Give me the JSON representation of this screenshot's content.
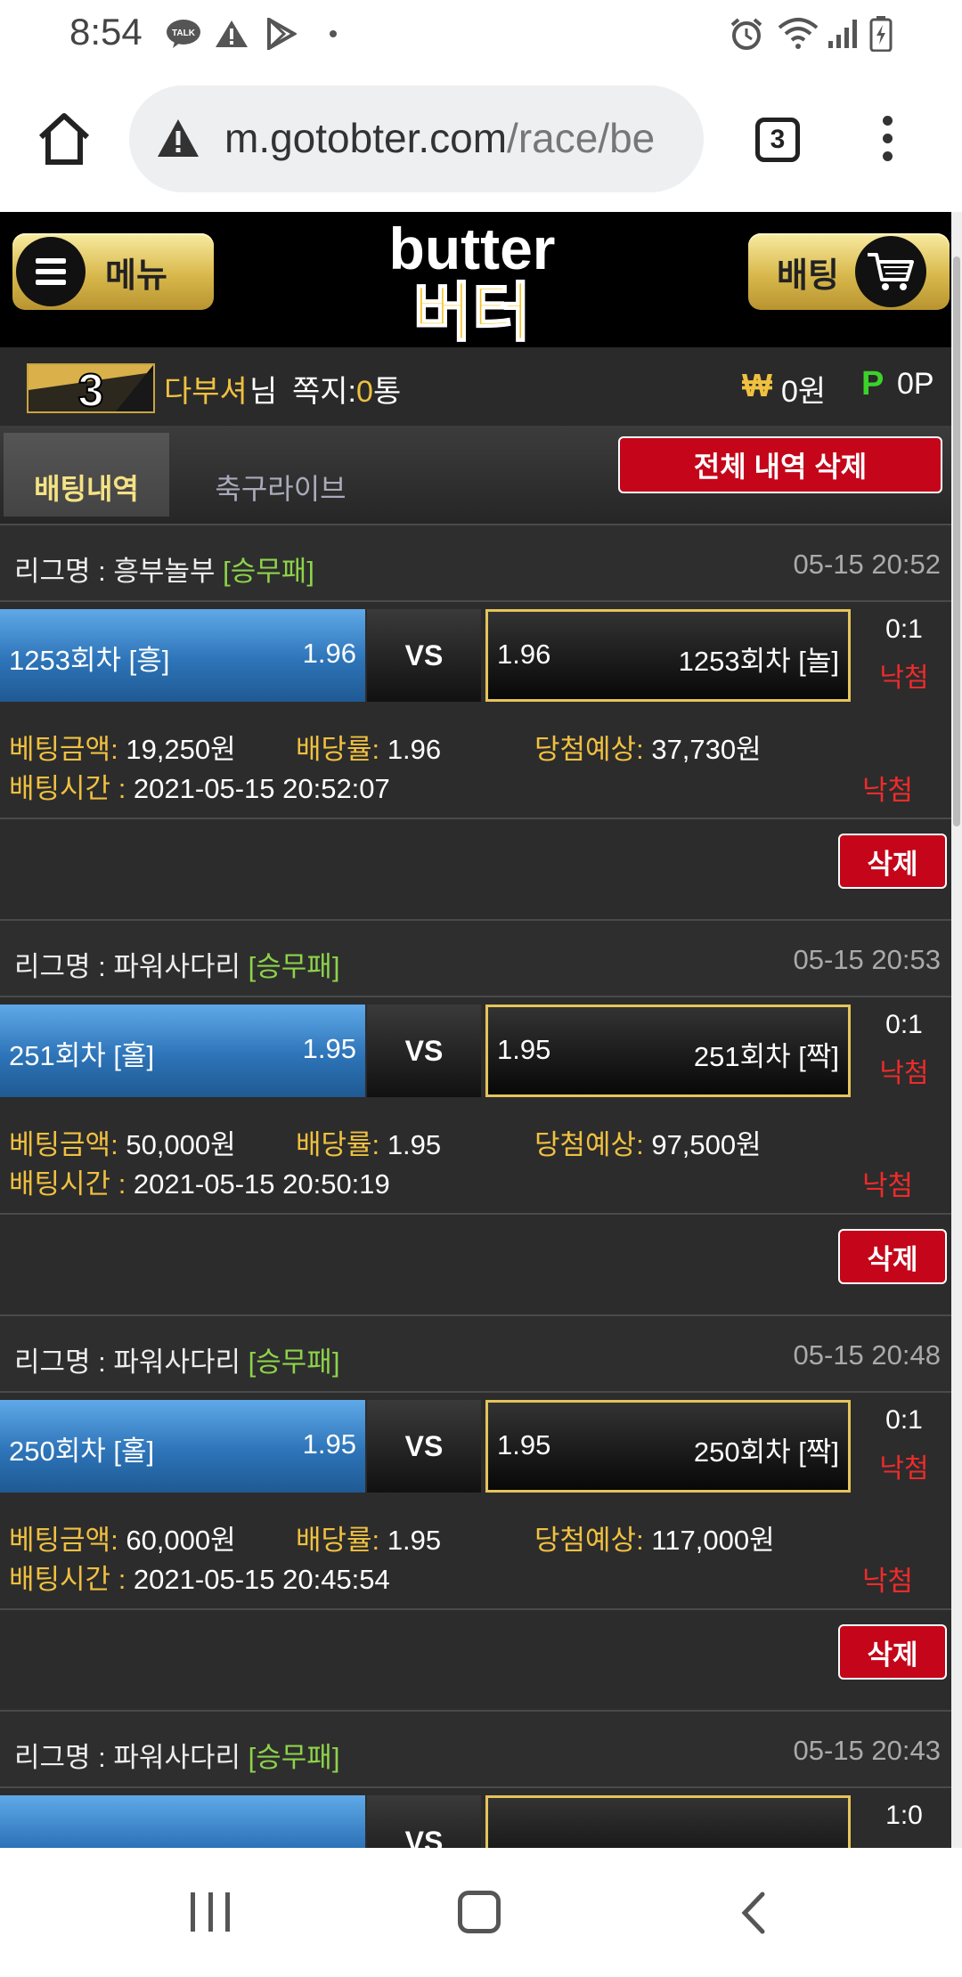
{
  "status_bar": {
    "time": "8:54",
    "left_icons": [
      "talk-icon",
      "warning-icon",
      "play-store-icon",
      "dot-icon"
    ],
    "right_icons": [
      "alarm-icon",
      "wifi-icon",
      "signal-icon",
      "battery-charging-icon"
    ]
  },
  "browser": {
    "url_domain": "m.gotobter.com",
    "url_path": "/race/be",
    "tab_count": "3"
  },
  "site": {
    "menu_label": "메뉴",
    "bet_label": "배팅",
    "logo_en": "butter",
    "logo_ko": "버터"
  },
  "user": {
    "level": "3",
    "name": "다부셔",
    "name_suffix": "님",
    "message_label": "쪽지:",
    "message_count": "0",
    "message_unit": "통",
    "won_symbol": "₩",
    "won_value": "0원",
    "point_symbol": "P",
    "point_value": "0P"
  },
  "tabs": {
    "active": "배팅내역",
    "idle": "축구라이브",
    "delete_all": "전체 내역 삭제"
  },
  "labels": {
    "league_prefix": "리그명 : ",
    "vs": "VS",
    "amount": "베팅금액:",
    "rate": "배당률:",
    "expected": "당첨예상:",
    "time": "배팅시간 : ",
    "delete": "삭제"
  },
  "bets": [
    {
      "league": "흥부놀부",
      "type": "[승무패]",
      "date": "05-15 20:52",
      "home": "1253회차 [흥]",
      "home_odds": "1.96",
      "away_odds": "1.96",
      "away": "1253회차 [놀]",
      "score": "0:1",
      "status": "낙첨",
      "amount": "19,250원",
      "rate": "1.96",
      "expected": "37,730원",
      "time": "2021-05-15 20:52:07",
      "result": "낙첨"
    },
    {
      "league": "파워사다리",
      "type": "[승무패]",
      "date": "05-15 20:53",
      "home": "251회차 [홀]",
      "home_odds": "1.95",
      "away_odds": "1.95",
      "away": "251회차 [짝]",
      "score": "0:1",
      "status": "낙첨",
      "amount": "50,000원",
      "rate": "1.95",
      "expected": "97,500원",
      "time": "2021-05-15 20:50:19",
      "result": "낙첨"
    },
    {
      "league": "파워사다리",
      "type": "[승무패]",
      "date": "05-15 20:48",
      "home": "250회차 [홀]",
      "home_odds": "1.95",
      "away_odds": "1.95",
      "away": "250회차 [짝]",
      "score": "0:1",
      "status": "낙첨",
      "amount": "60,000원",
      "rate": "1.95",
      "expected": "117,000원",
      "time": "2021-05-15 20:45:54",
      "result": "낙첨"
    },
    {
      "league": "파워사다리",
      "type": "[승무패]",
      "date": "05-15 20:43",
      "score": "1:0"
    }
  ]
}
